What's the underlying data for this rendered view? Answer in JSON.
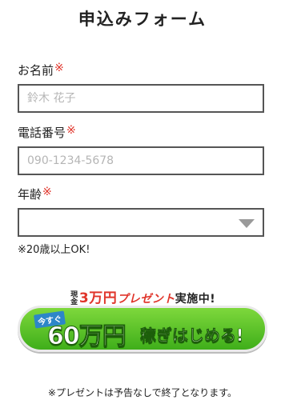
{
  "form": {
    "title": "申込みフォーム",
    "required_mark": "※",
    "name": {
      "label": "お名前",
      "placeholder": "鈴木 花子"
    },
    "phone": {
      "label": "電話番号",
      "placeholder": "090-1234-5678"
    },
    "age": {
      "label": "年齢",
      "value": "",
      "note": "※20歳以上OK!"
    }
  },
  "promo": {
    "prefix_small": "現金",
    "amount": "3万円",
    "prize": "プレゼント",
    "suffix": "実施中!"
  },
  "cta": {
    "ribbon": "今すぐ",
    "big": "60万円",
    "rest": "稼ぎはじめる!",
    "colors": {
      "top": "#7ed83c",
      "bottom": "#3fae1a"
    }
  },
  "disclaimer": "※プレゼントは予告なしで終了となります。"
}
